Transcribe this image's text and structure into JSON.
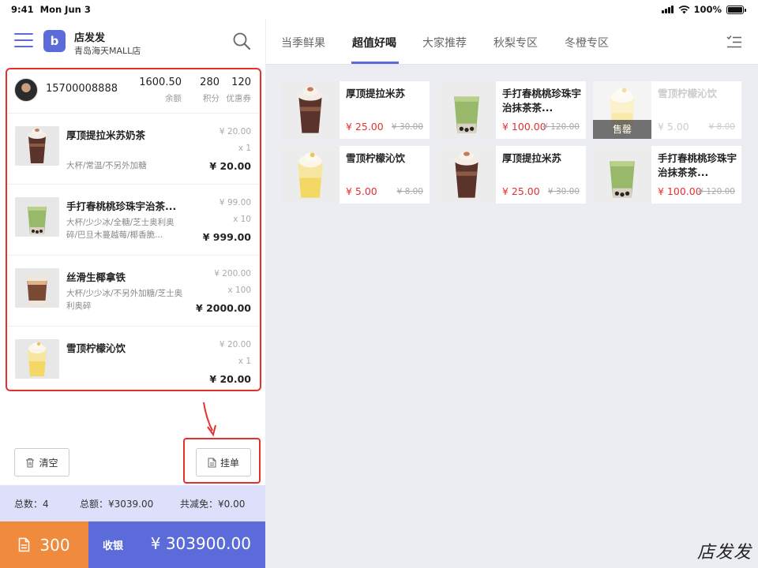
{
  "status_bar": {
    "time": "9:41",
    "date": "Mon Jun 3",
    "battery": "100%"
  },
  "header": {
    "store_name": "店发发",
    "store_sub": "青岛海天MALL店",
    "logo_glyph": "b"
  },
  "member": {
    "phone": "15700008888",
    "balance": "1600.50",
    "balance_label": "余额",
    "points": "280",
    "points_label": "积分",
    "coupons": "120",
    "coupons_label": "优惠券"
  },
  "cart": {
    "items": [
      {
        "name": "厚顶提拉米苏奶茶",
        "spec": "大杯/常温/不另外加糖",
        "orig": "¥ 20.00",
        "qty": "x 1",
        "total": "¥ 20.00",
        "drink": "tiramisu"
      },
      {
        "name": "手打春桃桃珍珠宇治茶...",
        "spec": "大杯/少少冰/全糖/芝士奥利奥碎/巴旦木蔓越莓/椰香脆...",
        "orig": "¥ 99.00",
        "qty": "x 10",
        "total": "¥ 999.00",
        "drink": "matcha"
      },
      {
        "name": "丝滑生椰拿铁",
        "spec": "大杯/少少冰/不另外加糖/芝士奥利奥碎",
        "orig": "¥ 200.00",
        "qty": "x 100",
        "total": "¥ 2000.00",
        "drink": "latte"
      },
      {
        "name": "雪顶柠檬沁饮",
        "spec": "",
        "orig": "¥ 20.00",
        "qty": "x 1",
        "total": "¥ 20.00",
        "drink": "lemon"
      }
    ]
  },
  "actions": {
    "clear_label": "清空",
    "hang_label": "挂单"
  },
  "summary": {
    "count": "总数：4",
    "total": "总额：¥3039.00",
    "discount": "共减免：¥0.00"
  },
  "footer": {
    "order_count": "300",
    "pay_label": "收银",
    "pay_amount": "¥ 303900.00"
  },
  "tabs": [
    {
      "label": "当季鲜果",
      "active": false
    },
    {
      "label": "超值好喝",
      "active": true
    },
    {
      "label": "大家推荐",
      "active": false
    },
    {
      "label": "秋梨专区",
      "active": false
    },
    {
      "label": "冬橙专区",
      "active": false
    }
  ],
  "products": [
    {
      "name": "厚顶提拉米苏",
      "price": "¥ 25.00",
      "orig": "¥ 30.00",
      "drink": "tiramisu",
      "sold_out": false
    },
    {
      "name": "手打春桃桃珍珠宇治抹茶茶...",
      "price": "¥ 100.00",
      "orig": "¥ 120.00",
      "drink": "matcha",
      "sold_out": false
    },
    {
      "name": "雪顶柠檬沁饮",
      "price": "¥ 5.00",
      "orig": "¥ 8.00",
      "drink": "lemon",
      "sold_out": true,
      "badge": "售罄"
    },
    {
      "name": "雪顶柠檬沁饮",
      "price": "¥ 5.00",
      "orig": "¥ 8.00",
      "drink": "lemon",
      "sold_out": false
    },
    {
      "name": "厚顶提拉米苏",
      "price": "¥ 25.00",
      "orig": "¥ 30.00",
      "drink": "tiramisu",
      "sold_out": false
    },
    {
      "name": "手打春桃桃珍珠宇治抹茶茶...",
      "price": "¥ 100.00",
      "orig": "¥ 120.00",
      "drink": "matcha",
      "sold_out": false
    }
  ],
  "watermark": "店发发",
  "colors": {
    "accent": "#5b6bd9",
    "orange": "#f08a3c",
    "price_red": "#e53030",
    "highlight_red": "#e53030"
  },
  "icons": {
    "menu": "hamburger-icon",
    "search": "search-icon",
    "trash": "trash-icon",
    "document": "document-icon",
    "list": "checklist-icon"
  }
}
